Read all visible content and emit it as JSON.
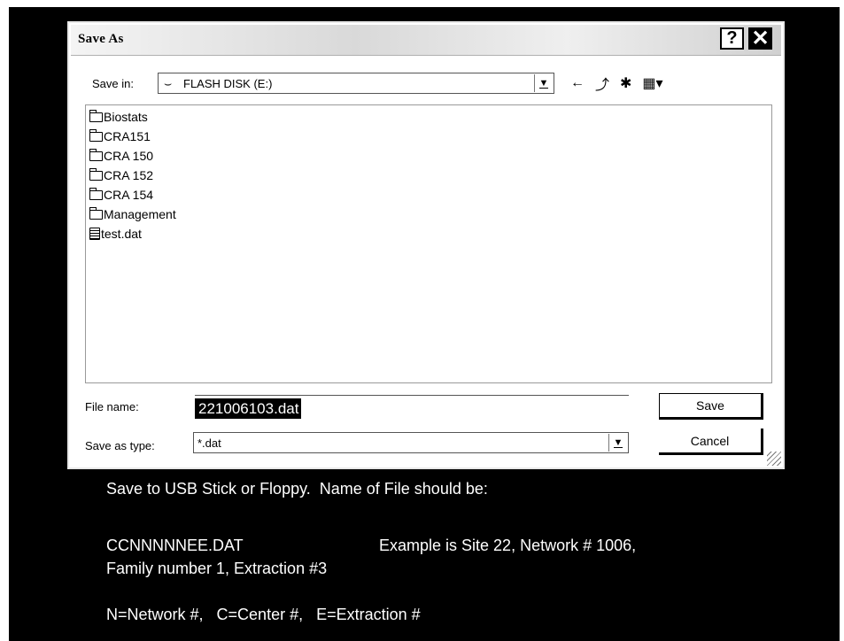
{
  "dialog": {
    "title": "Save As",
    "help_glyph": "?",
    "close_glyph": "✕"
  },
  "save_in": {
    "label": "Save in:",
    "value": "FLASH DISK (E:)",
    "drive_icon": "usb-drive-icon"
  },
  "toolbar": {
    "back_glyph": "←",
    "up_glyph": "⤴",
    "new_folder_glyph": "✱",
    "views_glyph": "▦▾"
  },
  "files": [
    {
      "name": "Biostats",
      "type": "folder"
    },
    {
      "name": "CRA151",
      "type": "folder"
    },
    {
      "name": "CRA 150",
      "type": "folder"
    },
    {
      "name": "CRA 152",
      "type": "folder"
    },
    {
      "name": "CRA 154",
      "type": "folder"
    },
    {
      "name": "Management",
      "type": "folder"
    },
    {
      "name": "test.dat",
      "type": "file"
    }
  ],
  "file_name": {
    "label": "File name:",
    "value": "221006103.dat"
  },
  "file_type": {
    "label": "Save as type:",
    "value": "*.dat"
  },
  "buttons": {
    "save": "Save",
    "cancel": "Cancel"
  },
  "instructions": {
    "line1": "Save to USB Stick or Floppy.  Name of File should be:",
    "line2a": "CCNNNNNEE.DAT",
    "line2b": "Example is Site 22, Network # 1006,",
    "line3": "Family number 1, Extraction #3",
    "line4": "N=Network #,   C=Center #,   E=Extraction #"
  }
}
